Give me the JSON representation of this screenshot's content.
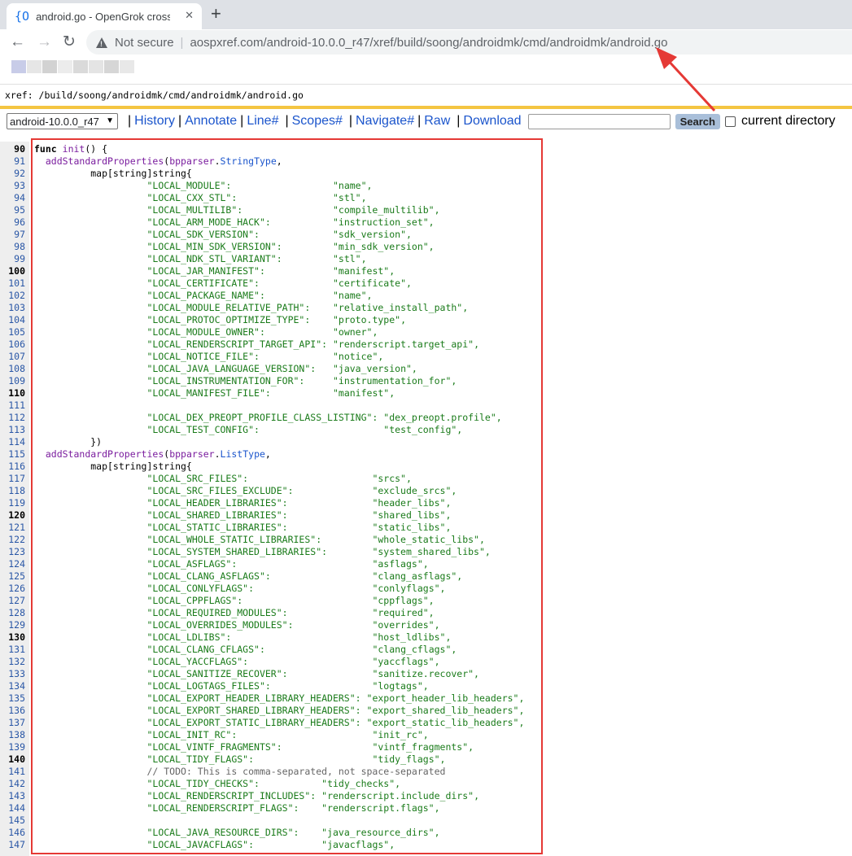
{
  "browser": {
    "tab_favicon": "{O",
    "tab_title": "android.go - OpenGrok cross r",
    "tab_close": "✕",
    "new_tab": "+",
    "back_icon": "←",
    "forward_icon": "→",
    "reload_icon": "↻",
    "not_secure": "Not secure",
    "separator": "|",
    "url": "aospxref.com/android-10.0.0_r47/xref/build/soong/androidmk/cmd/androidmk/android.go"
  },
  "xref": {
    "path": "xref: /build/soong/androidmk/cmd/androidmk/android.go"
  },
  "menu": {
    "revision": "android-10.0.0_r47",
    "history": "History",
    "annotate": "Annotate",
    "line": "Line#",
    "scopes": "Scopes#",
    "navigate": "Navigate#",
    "raw": "Raw",
    "download": "Download",
    "search_button": "Search",
    "current_directory": "current directory",
    "sep": "|"
  },
  "colors": {
    "highlight": "#e53935",
    "link": "#1b55cc",
    "gold": "#f4c542"
  },
  "code": [
    {
      "n": "90",
      "b": true,
      "p": [
        [
          "func",
          "k"
        ],
        [
          " "
        ],
        [
          "init",
          "f"
        ],
        [
          "() {"
        ]
      ]
    },
    {
      "n": "91",
      "p": [
        [
          "  "
        ],
        [
          "addStandardProperties",
          "f"
        ],
        [
          "("
        ],
        [
          "bpparser",
          "f"
        ],
        [
          "."
        ],
        [
          "StringType",
          "t"
        ],
        [
          ","
        ]
      ]
    },
    {
      "n": "92",
      "p": [
        [
          "          map[string]string{"
        ]
      ]
    },
    {
      "n": "93",
      "p": [
        [
          "                    "
        ],
        [
          "\"LOCAL_MODULE\":",
          "s"
        ],
        [
          "                  "
        ],
        [
          "\"name\",",
          "s"
        ]
      ]
    },
    {
      "n": "94",
      "p": [
        [
          "                    "
        ],
        [
          "\"LOCAL_CXX_STL\":",
          "s"
        ],
        [
          "                 "
        ],
        [
          "\"stl\",",
          "s"
        ]
      ]
    },
    {
      "n": "95",
      "p": [
        [
          "                    "
        ],
        [
          "\"LOCAL_MULTILIB\":",
          "s"
        ],
        [
          "                "
        ],
        [
          "\"compile_multilib\",",
          "s"
        ]
      ]
    },
    {
      "n": "96",
      "p": [
        [
          "                    "
        ],
        [
          "\"LOCAL_ARM_MODE_HACK\":",
          "s"
        ],
        [
          "           "
        ],
        [
          "\"instruction_set\",",
          "s"
        ]
      ]
    },
    {
      "n": "97",
      "p": [
        [
          "                    "
        ],
        [
          "\"LOCAL_SDK_VERSION\":",
          "s"
        ],
        [
          "             "
        ],
        [
          "\"sdk_version\",",
          "s"
        ]
      ]
    },
    {
      "n": "98",
      "p": [
        [
          "                    "
        ],
        [
          "\"LOCAL_MIN_SDK_VERSION\":",
          "s"
        ],
        [
          "         "
        ],
        [
          "\"min_sdk_version\",",
          "s"
        ]
      ]
    },
    {
      "n": "99",
      "p": [
        [
          "                    "
        ],
        [
          "\"LOCAL_NDK_STL_VARIANT\":",
          "s"
        ],
        [
          "         "
        ],
        [
          "\"stl\",",
          "s"
        ]
      ]
    },
    {
      "n": "100",
      "b": true,
      "p": [
        [
          "                    "
        ],
        [
          "\"LOCAL_JAR_MANIFEST\":",
          "s"
        ],
        [
          "            "
        ],
        [
          "\"manifest\",",
          "s"
        ]
      ]
    },
    {
      "n": "101",
      "p": [
        [
          "                    "
        ],
        [
          "\"LOCAL_CERTIFICATE\":",
          "s"
        ],
        [
          "             "
        ],
        [
          "\"certificate\",",
          "s"
        ]
      ]
    },
    {
      "n": "102",
      "p": [
        [
          "                    "
        ],
        [
          "\"LOCAL_PACKAGE_NAME\":",
          "s"
        ],
        [
          "            "
        ],
        [
          "\"name\",",
          "s"
        ]
      ]
    },
    {
      "n": "103",
      "p": [
        [
          "                    "
        ],
        [
          "\"LOCAL_MODULE_RELATIVE_PATH\":",
          "s"
        ],
        [
          "    "
        ],
        [
          "\"relative_install_path\",",
          "s"
        ]
      ]
    },
    {
      "n": "104",
      "p": [
        [
          "                    "
        ],
        [
          "\"LOCAL_PROTOC_OPTIMIZE_TYPE\":",
          "s"
        ],
        [
          "    "
        ],
        [
          "\"proto.type\",",
          "s"
        ]
      ]
    },
    {
      "n": "105",
      "p": [
        [
          "                    "
        ],
        [
          "\"LOCAL_MODULE_OWNER\":",
          "s"
        ],
        [
          "            "
        ],
        [
          "\"owner\",",
          "s"
        ]
      ]
    },
    {
      "n": "106",
      "p": [
        [
          "                    "
        ],
        [
          "\"LOCAL_RENDERSCRIPT_TARGET_API\":",
          "s"
        ],
        [
          " "
        ],
        [
          "\"renderscript.target_api\",",
          "s"
        ]
      ]
    },
    {
      "n": "107",
      "p": [
        [
          "                    "
        ],
        [
          "\"LOCAL_NOTICE_FILE\":",
          "s"
        ],
        [
          "             "
        ],
        [
          "\"notice\",",
          "s"
        ]
      ]
    },
    {
      "n": "108",
      "p": [
        [
          "                    "
        ],
        [
          "\"LOCAL_JAVA_LANGUAGE_VERSION\":",
          "s"
        ],
        [
          "   "
        ],
        [
          "\"java_version\",",
          "s"
        ]
      ]
    },
    {
      "n": "109",
      "p": [
        [
          "                    "
        ],
        [
          "\"LOCAL_INSTRUMENTATION_FOR\":",
          "s"
        ],
        [
          "     "
        ],
        [
          "\"instrumentation_for\",",
          "s"
        ]
      ]
    },
    {
      "n": "110",
      "b": true,
      "p": [
        [
          "                    "
        ],
        [
          "\"LOCAL_MANIFEST_FILE\":",
          "s"
        ],
        [
          "           "
        ],
        [
          "\"manifest\",",
          "s"
        ]
      ]
    },
    {
      "n": "111",
      "p": []
    },
    {
      "n": "112",
      "p": [
        [
          "                    "
        ],
        [
          "\"LOCAL_DEX_PREOPT_PROFILE_CLASS_LISTING\":",
          "s"
        ],
        [
          " "
        ],
        [
          "\"dex_preopt.profile\",",
          "s"
        ]
      ]
    },
    {
      "n": "113",
      "p": [
        [
          "                    "
        ],
        [
          "\"LOCAL_TEST_CONFIG\":",
          "s"
        ],
        [
          "                      "
        ],
        [
          "\"test_config\",",
          "s"
        ]
      ]
    },
    {
      "n": "114",
      "p": [
        [
          "          })"
        ]
      ]
    },
    {
      "n": "115",
      "p": [
        [
          "  "
        ],
        [
          "addStandardProperties",
          "f"
        ],
        [
          "("
        ],
        [
          "bpparser",
          "f"
        ],
        [
          "."
        ],
        [
          "ListType",
          "t"
        ],
        [
          ","
        ]
      ]
    },
    {
      "n": "116",
      "p": [
        [
          "          map[string]string{"
        ]
      ]
    },
    {
      "n": "117",
      "p": [
        [
          "                    "
        ],
        [
          "\"LOCAL_SRC_FILES\":",
          "s"
        ],
        [
          "                      "
        ],
        [
          "\"srcs\",",
          "s"
        ]
      ]
    },
    {
      "n": "118",
      "p": [
        [
          "                    "
        ],
        [
          "\"LOCAL_SRC_FILES_EXCLUDE\":",
          "s"
        ],
        [
          "              "
        ],
        [
          "\"exclude_srcs\",",
          "s"
        ]
      ]
    },
    {
      "n": "119",
      "p": [
        [
          "                    "
        ],
        [
          "\"LOCAL_HEADER_LIBRARIES\":",
          "s"
        ],
        [
          "               "
        ],
        [
          "\"header_libs\",",
          "s"
        ]
      ]
    },
    {
      "n": "120",
      "b": true,
      "p": [
        [
          "                    "
        ],
        [
          "\"LOCAL_SHARED_LIBRARIES\":",
          "s"
        ],
        [
          "               "
        ],
        [
          "\"shared_libs\",",
          "s"
        ]
      ]
    },
    {
      "n": "121",
      "p": [
        [
          "                    "
        ],
        [
          "\"LOCAL_STATIC_LIBRARIES\":",
          "s"
        ],
        [
          "               "
        ],
        [
          "\"static_libs\",",
          "s"
        ]
      ]
    },
    {
      "n": "122",
      "p": [
        [
          "                    "
        ],
        [
          "\"LOCAL_WHOLE_STATIC_LIBRARIES\":",
          "s"
        ],
        [
          "         "
        ],
        [
          "\"whole_static_libs\",",
          "s"
        ]
      ]
    },
    {
      "n": "123",
      "p": [
        [
          "                    "
        ],
        [
          "\"LOCAL_SYSTEM_SHARED_LIBRARIES\":",
          "s"
        ],
        [
          "        "
        ],
        [
          "\"system_shared_libs\",",
          "s"
        ]
      ]
    },
    {
      "n": "124",
      "p": [
        [
          "                    "
        ],
        [
          "\"LOCAL_ASFLAGS\":",
          "s"
        ],
        [
          "                        "
        ],
        [
          "\"asflags\",",
          "s"
        ]
      ]
    },
    {
      "n": "125",
      "p": [
        [
          "                    "
        ],
        [
          "\"LOCAL_CLANG_ASFLAGS\":",
          "s"
        ],
        [
          "                  "
        ],
        [
          "\"clang_asflags\",",
          "s"
        ]
      ]
    },
    {
      "n": "126",
      "p": [
        [
          "                    "
        ],
        [
          "\"LOCAL_CONLYFLAGS\":",
          "s"
        ],
        [
          "                     "
        ],
        [
          "\"conlyflags\",",
          "s"
        ]
      ]
    },
    {
      "n": "127",
      "p": [
        [
          "                    "
        ],
        [
          "\"LOCAL_CPPFLAGS\":",
          "s"
        ],
        [
          "                       "
        ],
        [
          "\"cppflags\",",
          "s"
        ]
      ]
    },
    {
      "n": "128",
      "p": [
        [
          "                    "
        ],
        [
          "\"LOCAL_REQUIRED_MODULES\":",
          "s"
        ],
        [
          "               "
        ],
        [
          "\"required\",",
          "s"
        ]
      ]
    },
    {
      "n": "129",
      "p": [
        [
          "                    "
        ],
        [
          "\"LOCAL_OVERRIDES_MODULES\":",
          "s"
        ],
        [
          "              "
        ],
        [
          "\"overrides\",",
          "s"
        ]
      ]
    },
    {
      "n": "130",
      "b": true,
      "p": [
        [
          "                    "
        ],
        [
          "\"LOCAL_LDLIBS\":",
          "s"
        ],
        [
          "                         "
        ],
        [
          "\"host_ldlibs\",",
          "s"
        ]
      ]
    },
    {
      "n": "131",
      "p": [
        [
          "                    "
        ],
        [
          "\"LOCAL_CLANG_CFLAGS\":",
          "s"
        ],
        [
          "                   "
        ],
        [
          "\"clang_cflags\",",
          "s"
        ]
      ]
    },
    {
      "n": "132",
      "p": [
        [
          "                    "
        ],
        [
          "\"LOCAL_YACCFLAGS\":",
          "s"
        ],
        [
          "                      "
        ],
        [
          "\"yaccflags\",",
          "s"
        ]
      ]
    },
    {
      "n": "133",
      "p": [
        [
          "                    "
        ],
        [
          "\"LOCAL_SANITIZE_RECOVER\":",
          "s"
        ],
        [
          "               "
        ],
        [
          "\"sanitize.recover\",",
          "s"
        ]
      ]
    },
    {
      "n": "134",
      "p": [
        [
          "                    "
        ],
        [
          "\"LOCAL_LOGTAGS_FILES\":",
          "s"
        ],
        [
          "                  "
        ],
        [
          "\"logtags\",",
          "s"
        ]
      ]
    },
    {
      "n": "135",
      "p": [
        [
          "                    "
        ],
        [
          "\"LOCAL_EXPORT_HEADER_LIBRARY_HEADERS\":",
          "s"
        ],
        [
          " "
        ],
        [
          "\"export_header_lib_headers\",",
          "s"
        ]
      ]
    },
    {
      "n": "136",
      "p": [
        [
          "                    "
        ],
        [
          "\"LOCAL_EXPORT_SHARED_LIBRARY_HEADERS\":",
          "s"
        ],
        [
          " "
        ],
        [
          "\"export_shared_lib_headers\",",
          "s"
        ]
      ]
    },
    {
      "n": "137",
      "p": [
        [
          "                    "
        ],
        [
          "\"LOCAL_EXPORT_STATIC_LIBRARY_HEADERS\":",
          "s"
        ],
        [
          " "
        ],
        [
          "\"export_static_lib_headers\",",
          "s"
        ]
      ]
    },
    {
      "n": "138",
      "p": [
        [
          "                    "
        ],
        [
          "\"LOCAL_INIT_RC\":",
          "s"
        ],
        [
          "                        "
        ],
        [
          "\"init_rc\",",
          "s"
        ]
      ]
    },
    {
      "n": "139",
      "p": [
        [
          "                    "
        ],
        [
          "\"LOCAL_VINTF_FRAGMENTS\":",
          "s"
        ],
        [
          "                "
        ],
        [
          "\"vintf_fragments\",",
          "s"
        ]
      ]
    },
    {
      "n": "140",
      "b": true,
      "p": [
        [
          "                    "
        ],
        [
          "\"LOCAL_TIDY_FLAGS\":",
          "s"
        ],
        [
          "                     "
        ],
        [
          "\"tidy_flags\",",
          "s"
        ]
      ]
    },
    {
      "n": "141",
      "p": [
        [
          "                    "
        ],
        [
          "// TODO: This is comma-separated, not space-separated",
          "c"
        ]
      ]
    },
    {
      "n": "142",
      "p": [
        [
          "                    "
        ],
        [
          "\"LOCAL_TIDY_CHECKS\":",
          "s"
        ],
        [
          "           "
        ],
        [
          "\"tidy_checks\",",
          "s"
        ]
      ]
    },
    {
      "n": "143",
      "p": [
        [
          "                    "
        ],
        [
          "\"LOCAL_RENDERSCRIPT_INCLUDES\":",
          "s"
        ],
        [
          " "
        ],
        [
          "\"renderscript.include_dirs\",",
          "s"
        ]
      ]
    },
    {
      "n": "144",
      "p": [
        [
          "                    "
        ],
        [
          "\"LOCAL_RENDERSCRIPT_FLAGS\":",
          "s"
        ],
        [
          "    "
        ],
        [
          "\"renderscript.flags\",",
          "s"
        ]
      ]
    },
    {
      "n": "145",
      "p": []
    },
    {
      "n": "146",
      "p": [
        [
          "                    "
        ],
        [
          "\"LOCAL_JAVA_RESOURCE_DIRS\":",
          "s"
        ],
        [
          "    "
        ],
        [
          "\"java_resource_dirs\",",
          "s"
        ]
      ]
    },
    {
      "n": "147",
      "p": [
        [
          "                    "
        ],
        [
          "\"LOCAL_JAVACFLAGS\":",
          "s"
        ],
        [
          "            "
        ],
        [
          "\"javacflags\",",
          "s"
        ]
      ]
    }
  ]
}
